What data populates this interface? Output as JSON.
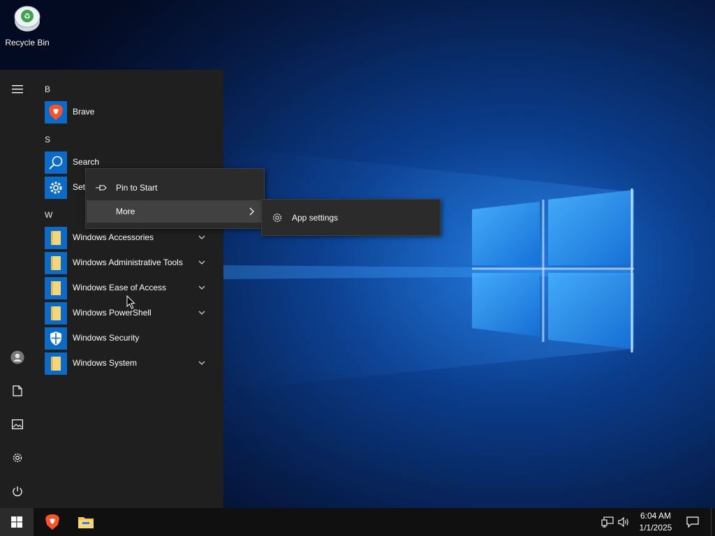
{
  "desktop": {
    "icons": [
      {
        "label": "Recycle Bin",
        "icon": "recycle-bin-icon"
      }
    ]
  },
  "start_menu": {
    "rail": {
      "icons": [
        "hamburger-menu-icon",
        "user-avatar-icon",
        "documents-icon",
        "pictures-icon",
        "settings-icon",
        "power-icon"
      ]
    },
    "groups": [
      {
        "letter": "B",
        "items": [
          {
            "label": "Brave",
            "icon": "brave-lion-icon"
          }
        ]
      },
      {
        "letter": "S",
        "items": [
          {
            "label": "Search",
            "icon": "search-icon"
          },
          {
            "label": "Settings",
            "icon": "settings-gear-icon"
          }
        ]
      },
      {
        "letter": "W",
        "items": [
          {
            "label": "Windows Accessories",
            "icon": "folder-icon",
            "expandable": true
          },
          {
            "label": "Windows Administrative Tools",
            "icon": "folder-icon",
            "expandable": true
          },
          {
            "label": "Windows Ease of Access",
            "icon": "folder-icon",
            "expandable": true
          },
          {
            "label": "Windows PowerShell",
            "icon": "folder-icon",
            "expandable": true
          },
          {
            "label": "Windows Security",
            "icon": "shield-icon",
            "expandable": false
          },
          {
            "label": "Windows System",
            "icon": "folder-icon",
            "expandable": true
          }
        ]
      }
    ]
  },
  "context_menu": {
    "items": [
      {
        "label": "Pin to Start",
        "icon": "pin-icon"
      },
      {
        "label": "More",
        "icon": "chevron-right-icon"
      }
    ],
    "submenu": {
      "items": [
        {
          "label": "App settings",
          "icon": "gear-icon"
        }
      ]
    }
  },
  "taskbar": {
    "apps": [
      "brave-icon",
      "file-explorer-icon"
    ],
    "tray": {
      "icons": [
        "network-icon",
        "volume-icon"
      ]
    },
    "clock": {
      "time": "6:04 AM",
      "date": "1/1/2025"
    },
    "notification_icon": "action-center-icon"
  },
  "colors": {
    "start_menu_bg": "#1f1f1f",
    "tile_blue": "#0b6bc7",
    "context_menu_bg": "#2b2b2b",
    "context_hover_bg": "#414141",
    "taskbar_bg": "#101010"
  }
}
